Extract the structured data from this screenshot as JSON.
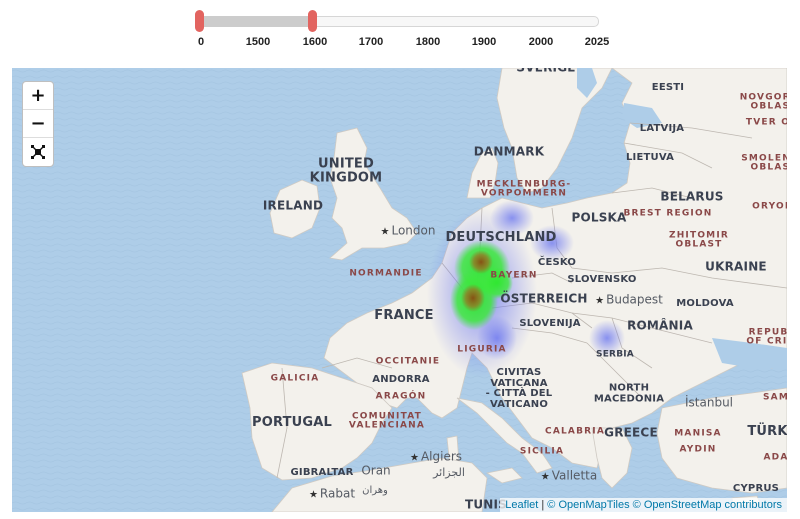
{
  "slider": {
    "ticks": [
      "0",
      "1500",
      "1600",
      "1700",
      "1800",
      "1900",
      "2000",
      "2025"
    ],
    "range_start": "0",
    "range_end": "1600",
    "colors": {
      "handle": "#e26460",
      "range": "#cccccc",
      "track": "#f7f7f7"
    }
  },
  "map": {
    "zoom_controls": {
      "zoom_in": "+",
      "zoom_out": "−",
      "fullscreen_icon": "fullscreen-icon"
    },
    "attribution": {
      "leaflet": "Leaflet",
      "separator": " | ",
      "openmaptiles": "© OpenMapTiles",
      "osm": "© OpenStreetMap contributors"
    },
    "countries": {
      "sverige": "SVERIGE",
      "eesti": "EESTI",
      "latvija": "LATVIJA",
      "lietuva": "LIETUVA",
      "danmark": "DANMARK",
      "uk_1": "UNITED",
      "uk_2": "KINGDOM",
      "ireland": "IRELAND",
      "belarus": "BELARUS",
      "polska": "POLSKA",
      "deutschland": "DEUTSCHLAND",
      "cesko": "ČESKO",
      "slovensko": "SLOVENSKO",
      "ukraine": "UKRAINE",
      "osterreich": "ÖSTERREICH",
      "moldova": "MOLDOVA",
      "france": "FRANCE",
      "slovenija": "SLOVENIJA",
      "romania": "ROMÂNIA",
      "serbia": "SERBIA",
      "andorra": "ANDORRA",
      "vatican_1": "CIVITAS",
      "vatican_2": "VATICANA",
      "vatican_3": "- CITTÀ DEL",
      "vatican_4": "VATICANO",
      "north_macedonia_1": "NORTH",
      "north_macedonia_2": "MACEDONIA",
      "portugal": "PORTUGAL",
      "greece": "GREECE",
      "turkiye": "TÜRKI",
      "gibraltar": "GIBRALTAR",
      "cyprus": "CYPRUS",
      "tunis": "TUNIS"
    },
    "regions": {
      "novgorod_1": "NOVGOROD",
      "novgorod_2": "OBLAST",
      "tver": "TVER OB",
      "smolensk_1": "SMOLENSK",
      "smolensk_2": "OBLAST",
      "mecklenburg_1": "MECKLENBURG-",
      "mecklenburg_2": "VORPOMMERN",
      "brest": "BREST REGION",
      "oryol": "ORYOL",
      "zhitomir_1": "ZHITOMIR",
      "zhitomir_2": "OBLAST",
      "normandie": "NORMANDIE",
      "bayern": "BAYERN",
      "crimea_1": "REPUBL",
      "crimea_2": "OF CRIM",
      "occitanie": "OCCITANIE",
      "liguria": "LIGURIA",
      "galicia": "GALICIA",
      "aragon": "ARAGÓN",
      "comunitat_1": "COMUNITAT",
      "comunitat_2": "VALENCIANA",
      "calabria": "CALABRIA",
      "sicilia": "SICILIA",
      "manisa": "MANISA",
      "aydin": "AYDIN",
      "sam": "SAM",
      "ada": "ADA"
    },
    "cities": {
      "london": "London",
      "budapest": "Budapest",
      "istanbul": "İstanbul",
      "algiers": "Algiers",
      "algiers_ar": "الجزائر",
      "oran": "Oran",
      "oran_ar": "وهران",
      "valletta": "Valletta",
      "rabat": "Rabat"
    },
    "heatmap": {
      "colors": {
        "low": "#6a78f0",
        "mid": "#3ee83e",
        "high": "#9a5a1a"
      },
      "hotspots": [
        {
          "name": "central-germany",
          "intensity": 1.0
        },
        {
          "name": "upper-rhine",
          "intensity": 1.0
        },
        {
          "name": "bavaria",
          "intensity": 0.6
        },
        {
          "name": "berlin",
          "intensity": 0.3
        },
        {
          "name": "bohemia",
          "intensity": 0.25
        },
        {
          "name": "switzerland",
          "intensity": 0.3
        },
        {
          "name": "serbia-hungary",
          "intensity": 0.3
        }
      ]
    }
  }
}
